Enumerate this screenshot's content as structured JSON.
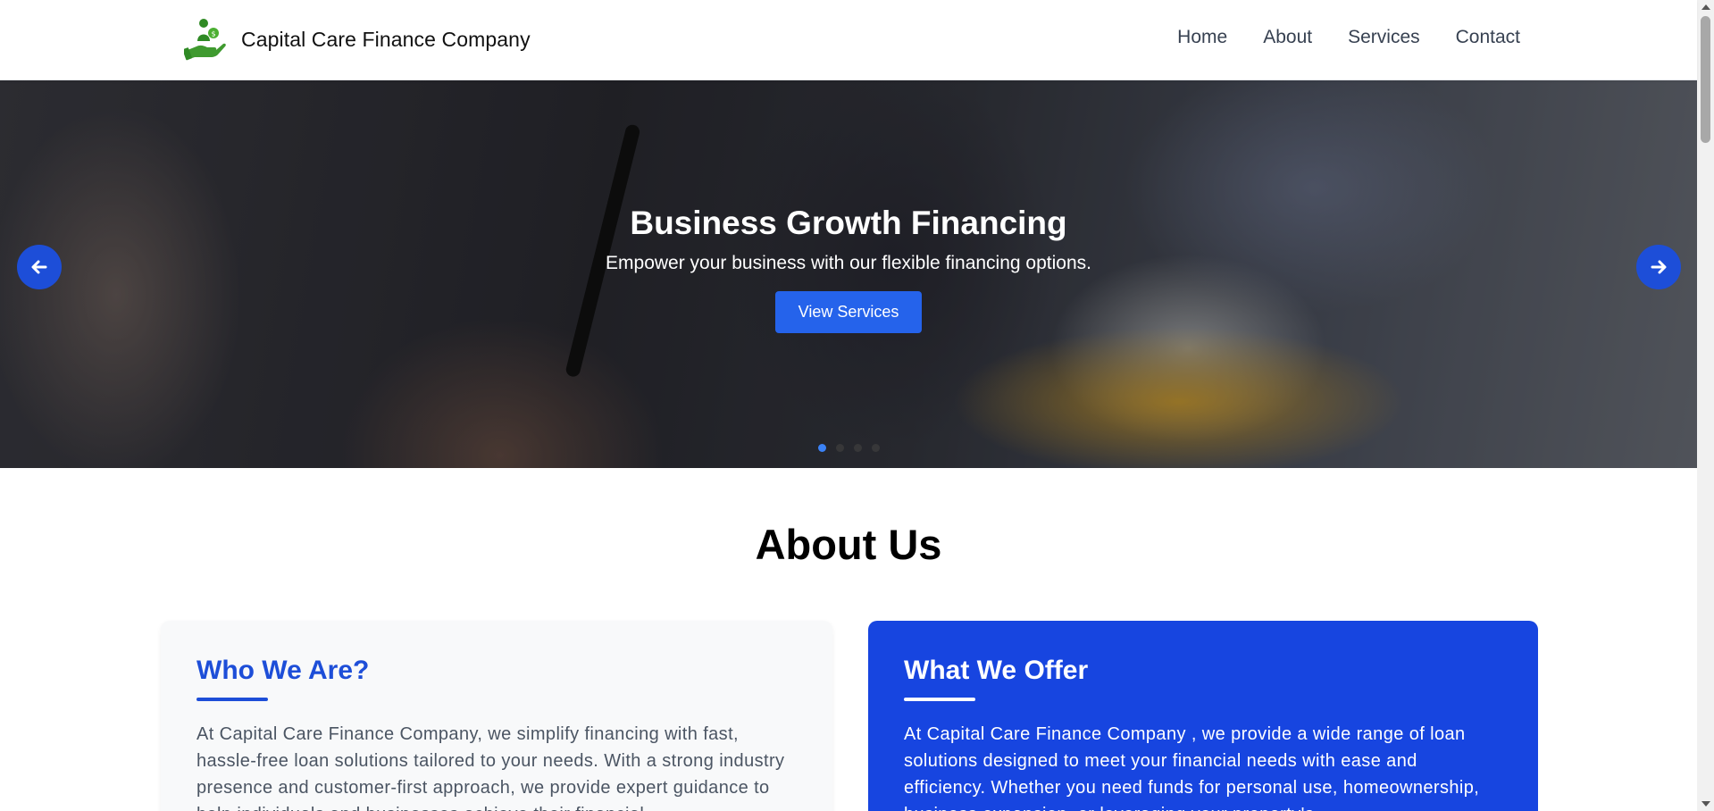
{
  "header": {
    "brand_name": "Capital Care Finance Company",
    "logo_icon": "hand-holding-money-person-icon",
    "nav": [
      "Home",
      "About",
      "Services",
      "Contact"
    ]
  },
  "hero": {
    "title": "Business Growth Financing",
    "subtitle": "Empower your business with our flexible financing options.",
    "button_label": "View Services",
    "prev_icon": "arrow-left-icon",
    "next_icon": "arrow-right-icon",
    "slide_count": 4,
    "active_slide": 1
  },
  "about": {
    "title": "About Us",
    "cards": [
      {
        "heading": "Who We Are?",
        "text": "At Capital Care Finance Company, we simplify financing with fast, hassle-free loan solutions tailored to your needs. With a strong industry presence and customer-first approach, we provide expert guidance to help individuals and businesses achieve their financial"
      },
      {
        "heading": "What We Offer",
        "text": "At Capital Care Finance Company , we provide a wide range of loan solutions designed to meet your financial needs with ease and efficiency. Whether you need funds for personal use, homeownership, business expansion, or leveraging your property's"
      }
    ]
  },
  "colors": {
    "primary": "#2563eb",
    "card_blue": "#1745e0",
    "heading_blue": "#1d4ed8",
    "logo_green": "#3f9a2f"
  }
}
